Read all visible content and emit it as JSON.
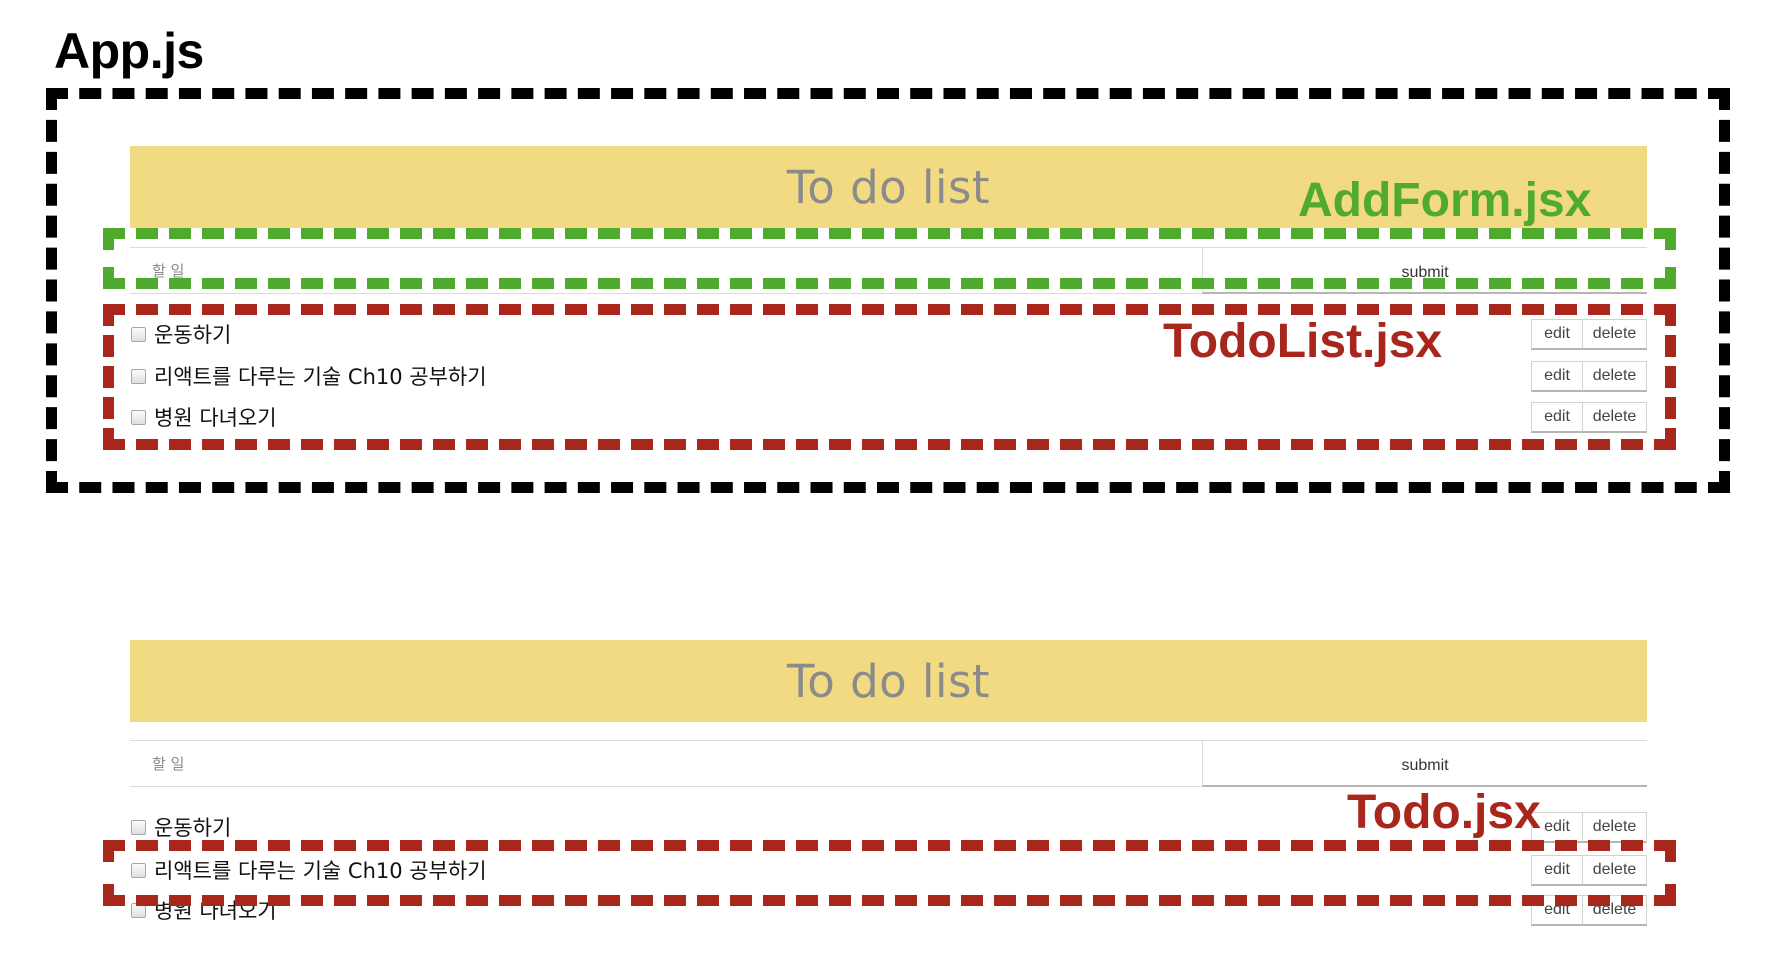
{
  "labels": {
    "app": "App.js",
    "addform": "AddForm.jsx",
    "todolist": "TodoList.jsx",
    "todo": "Todo.jsx"
  },
  "app": {
    "title": "To do list",
    "input_placeholder": "할 일",
    "submit_label": "submit",
    "edit_label": "edit",
    "delete_label": "delete",
    "todos": [
      "운동하기",
      "리액트를 다루는 기술 Ch10 공부하기",
      "병원 다녀오기"
    ]
  },
  "colors": {
    "banner": "#f2da82",
    "app_box": "#000000",
    "addform": "#4faa2e",
    "todolist": "#a8261b",
    "todo": "#a8261b"
  }
}
